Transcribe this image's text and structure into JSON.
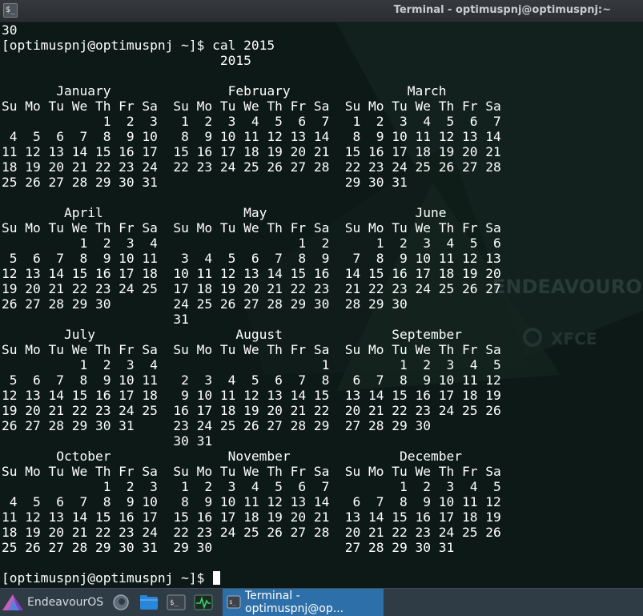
{
  "window": {
    "title": "Terminal - optimuspnj@optimuspnj:~",
    "icon": "terminal-icon"
  },
  "terminal": {
    "previous_output": "30",
    "command_prompt": "[optimuspnj@optimuspnj ~]$ ",
    "command": "cal 2015",
    "calendar": "                            2015\n\n       January               February               March\nSu Mo Tu We Th Fr Sa  Su Mo Tu We Th Fr Sa  Su Mo Tu We Th Fr Sa\n             1  2  3   1  2  3  4  5  6  7   1  2  3  4  5  6  7\n 4  5  6  7  8  9 10   8  9 10 11 12 13 14   8  9 10 11 12 13 14\n11 12 13 14 15 16 17  15 16 17 18 19 20 21  15 16 17 18 19 20 21\n18 19 20 21 22 23 24  22 23 24 25 26 27 28  22 23 24 25 26 27 28\n25 26 27 28 29 30 31                        29 30 31\n\n        April                  May                   June\nSu Mo Tu We Th Fr Sa  Su Mo Tu We Th Fr Sa  Su Mo Tu We Th Fr Sa\n          1  2  3  4                  1  2      1  2  3  4  5  6\n 5  6  7  8  9 10 11   3  4  5  6  7  8  9   7  8  9 10 11 12 13\n12 13 14 15 16 17 18  10 11 12 13 14 15 16  14 15 16 17 18 19 20\n19 20 21 22 23 24 25  17 18 19 20 21 22 23  21 22 23 24 25 26 27\n26 27 28 29 30        24 25 26 27 28 29 30  28 29 30\n                      31\n        July                  August              September\nSu Mo Tu We Th Fr Sa  Su Mo Tu We Th Fr Sa  Su Mo Tu We Th Fr Sa\n          1  2  3  4                     1         1  2  3  4  5\n 5  6  7  8  9 10 11   2  3  4  5  6  7  8   6  7  8  9 10 11 12\n12 13 14 15 16 17 18   9 10 11 12 13 14 15  13 14 15 16 17 18 19\n19 20 21 22 23 24 25  16 17 18 19 20 21 22  20 21 22 23 24 25 26\n26 27 28 29 30 31     23 24 25 26 27 28 29  27 28 29 30\n                      30 31\n       October               November              December\nSu Mo Tu We Th Fr Sa  Su Mo Tu We Th Fr Sa  Su Mo Tu We Th Fr Sa\n             1  2  3   1  2  3  4  5  6  7         1  2  3  4  5\n 4  5  6  7  8  9 10   8  9 10 11 12 13 14   6  7  8  9 10 11 12\n11 12 13 14 15 16 17  15 16 17 18 19 20 21  13 14 15 16 17 18 19\n18 19 20 21 22 23 24  22 23 24 25 26 27 28  20 21 22 23 24 25 26\n25 26 27 28 29 30 31  29 30                 27 28 29 30 31",
    "final_prompt": "[optimuspnj@optimuspnj ~]$ ",
    "wallpaper_text": "ENDEAVOUROS",
    "wallpaper_subtext": "XFCE"
  },
  "taskbar": {
    "menu_label": "EndeavourOS",
    "launchers": [
      {
        "name": "firefox-icon"
      },
      {
        "name": "file-manager-icon"
      },
      {
        "name": "terminal-launcher-icon"
      },
      {
        "name": "system-monitor-icon"
      }
    ],
    "active_window_label": "Terminal - optimuspnj@op..."
  },
  "colors": {
    "terminal_bg": "#0d1916",
    "text": "#ffffff",
    "taskbar_bg": "#2f3b45",
    "taskbar_active": "#2d6fa8",
    "accent_purple": "#7f3fbf"
  }
}
